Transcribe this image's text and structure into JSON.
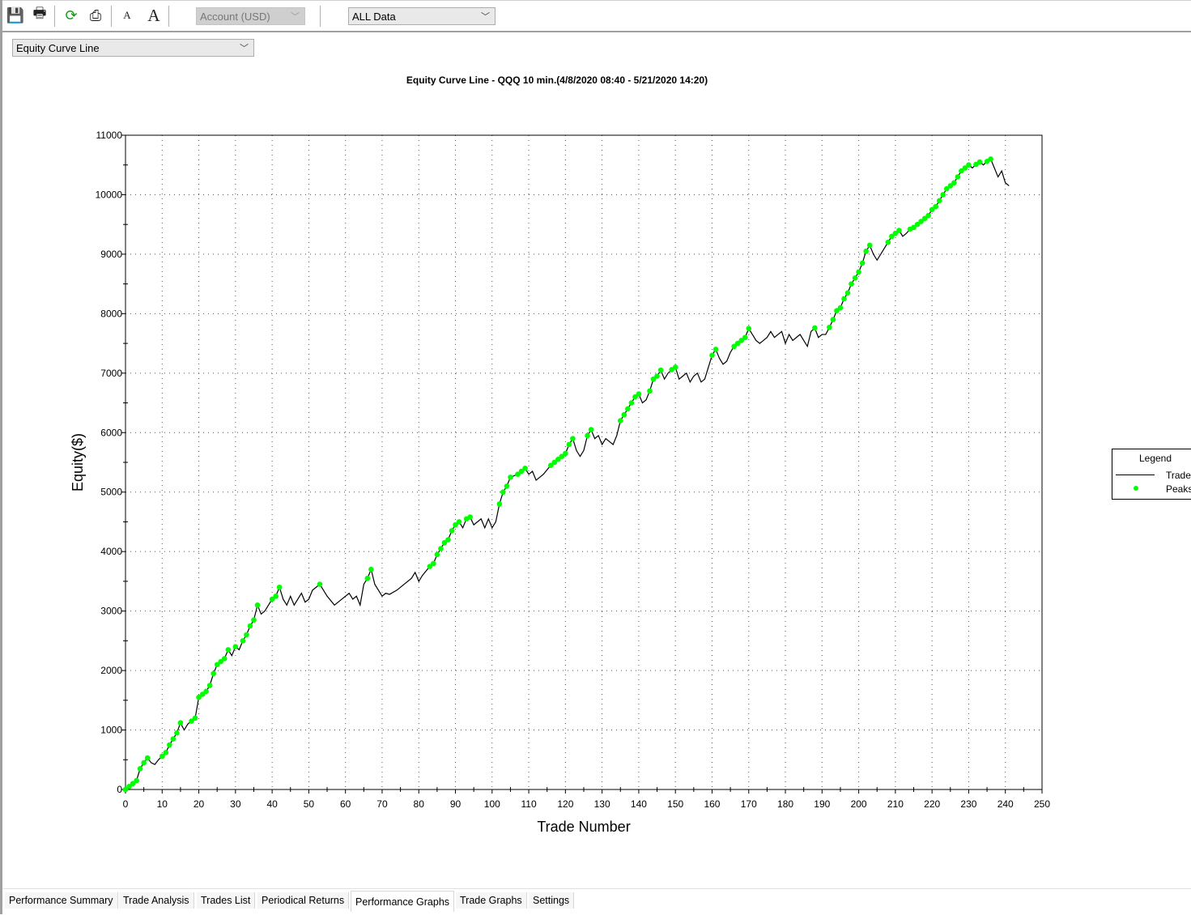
{
  "toolbar": {
    "buttons": [
      {
        "name": "save-icon",
        "glyph": "💾"
      },
      {
        "name": "print-icon",
        "glyph": "🖶"
      },
      {
        "name": "refresh-icon",
        "glyph": "⟳"
      },
      {
        "name": "export-icon",
        "glyph": "⎙"
      },
      {
        "name": "font-smaller-icon",
        "glyph": "A"
      },
      {
        "name": "font-larger-icon",
        "glyph": "A"
      }
    ],
    "account_select": "Account (USD)",
    "data_select": "ALL Data"
  },
  "graph_select": "Equity Curve Line",
  "legend": {
    "title": "Legend",
    "items": [
      "Trades",
      "Peaks"
    ]
  },
  "tabs": [
    {
      "label": "Performance Summary"
    },
    {
      "label": "Trade Analysis"
    },
    {
      "label": "Trades List"
    },
    {
      "label": "Periodical Returns"
    },
    {
      "label": "Performance Graphs",
      "active": true
    },
    {
      "label": "Trade Graphs"
    },
    {
      "label": "Settings"
    }
  ],
  "chart_data": {
    "type": "line",
    "title": "Equity Curve Line - QQQ 10 min.(4/8/2020 08:40 - 5/21/2020 14:20)",
    "xlabel": "Trade Number",
    "ylabel": "Equity($)",
    "xlim": [
      0,
      250
    ],
    "ylim": [
      0,
      11000
    ],
    "xticks": [
      0,
      10,
      20,
      30,
      40,
      50,
      60,
      70,
      80,
      90,
      100,
      110,
      120,
      130,
      140,
      150,
      160,
      170,
      180,
      190,
      200,
      210,
      220,
      230,
      240,
      250
    ],
    "yticks": [
      0,
      1000,
      2000,
      3000,
      4000,
      5000,
      6000,
      7000,
      8000,
      9000,
      10000,
      11000
    ],
    "grid": true,
    "legend_placement": "right",
    "colors": {
      "trades": "#000000",
      "peaks": "#00ff00"
    },
    "series": [
      {
        "name": "Trades",
        "points": [
          [
            0,
            0
          ],
          [
            1,
            50
          ],
          [
            2,
            100
          ],
          [
            3,
            150
          ],
          [
            4,
            350
          ],
          [
            5,
            450
          ],
          [
            6,
            530
          ],
          [
            7,
            450
          ],
          [
            8,
            420
          ],
          [
            9,
            500
          ],
          [
            10,
            560
          ],
          [
            11,
            620
          ],
          [
            12,
            750
          ],
          [
            13,
            850
          ],
          [
            14,
            950
          ],
          [
            15,
            1120
          ],
          [
            16,
            1000
          ],
          [
            17,
            1100
          ],
          [
            18,
            1150
          ],
          [
            19,
            1200
          ],
          [
            20,
            1550
          ],
          [
            21,
            1600
          ],
          [
            22,
            1650
          ],
          [
            23,
            1750
          ],
          [
            24,
            1950
          ],
          [
            25,
            2100
          ],
          [
            26,
            2150
          ],
          [
            27,
            2200
          ],
          [
            28,
            2350
          ],
          [
            29,
            2250
          ],
          [
            30,
            2400
          ],
          [
            31,
            2350
          ],
          [
            32,
            2500
          ],
          [
            33,
            2600
          ],
          [
            34,
            2750
          ],
          [
            35,
            2850
          ],
          [
            36,
            3100
          ],
          [
            37,
            2950
          ],
          [
            38,
            3000
          ],
          [
            39,
            3100
          ],
          [
            40,
            3200
          ],
          [
            41,
            3250
          ],
          [
            42,
            3400
          ],
          [
            43,
            3200
          ],
          [
            44,
            3100
          ],
          [
            45,
            3250
          ],
          [
            46,
            3100
          ],
          [
            47,
            3200
          ],
          [
            48,
            3300
          ],
          [
            49,
            3150
          ],
          [
            50,
            3200
          ],
          [
            51,
            3350
          ],
          [
            52,
            3400
          ],
          [
            53,
            3450
          ],
          [
            55,
            3250
          ],
          [
            57,
            3100
          ],
          [
            59,
            3200
          ],
          [
            61,
            3300
          ],
          [
            62,
            3200
          ],
          [
            63,
            3250
          ],
          [
            64,
            3100
          ],
          [
            65,
            3450
          ],
          [
            66,
            3550
          ],
          [
            67,
            3700
          ],
          [
            68,
            3450
          ],
          [
            70,
            3250
          ],
          [
            71,
            3300
          ],
          [
            72,
            3280
          ],
          [
            74,
            3350
          ],
          [
            76,
            3450
          ],
          [
            78,
            3550
          ],
          [
            79,
            3650
          ],
          [
            80,
            3500
          ],
          [
            81,
            3600
          ],
          [
            83,
            3750
          ],
          [
            84,
            3800
          ],
          [
            85,
            3950
          ],
          [
            86,
            4050
          ],
          [
            87,
            4150
          ],
          [
            88,
            4200
          ],
          [
            89,
            4350
          ],
          [
            90,
            4450
          ],
          [
            91,
            4500
          ],
          [
            92,
            4400
          ],
          [
            93,
            4550
          ],
          [
            94,
            4580
          ],
          [
            95,
            4450
          ],
          [
            97,
            4550
          ],
          [
            98,
            4400
          ],
          [
            99,
            4550
          ],
          [
            100,
            4400
          ],
          [
            101,
            4500
          ],
          [
            102,
            4800
          ],
          [
            103,
            5000
          ],
          [
            104,
            5100
          ],
          [
            105,
            5250
          ],
          [
            107,
            5300
          ],
          [
            108,
            5350
          ],
          [
            109,
            5400
          ],
          [
            110,
            5300
          ],
          [
            111,
            5350
          ],
          [
            112,
            5200
          ],
          [
            114,
            5300
          ],
          [
            116,
            5450
          ],
          [
            117,
            5500
          ],
          [
            118,
            5550
          ],
          [
            119,
            5600
          ],
          [
            120,
            5650
          ],
          [
            121,
            5800
          ],
          [
            122,
            5900
          ],
          [
            123,
            5700
          ],
          [
            124,
            5600
          ],
          [
            125,
            5700
          ],
          [
            126,
            5950
          ],
          [
            127,
            6050
          ],
          [
            128,
            5900
          ],
          [
            129,
            5950
          ],
          [
            130,
            5800
          ],
          [
            131,
            5900
          ],
          [
            132,
            5850
          ],
          [
            133,
            5800
          ],
          [
            134,
            5950
          ],
          [
            135,
            6200
          ],
          [
            136,
            6300
          ],
          [
            137,
            6400
          ],
          [
            138,
            6500
          ],
          [
            139,
            6600
          ],
          [
            140,
            6650
          ],
          [
            141,
            6500
          ],
          [
            142,
            6550
          ],
          [
            143,
            6700
          ],
          [
            144,
            6900
          ],
          [
            145,
            6950
          ],
          [
            146,
            7050
          ],
          [
            147,
            6900
          ],
          [
            148,
            7000
          ],
          [
            149,
            7060
          ],
          [
            150,
            7100
          ],
          [
            151,
            6900
          ],
          [
            152,
            6950
          ],
          [
            153,
            7000
          ],
          [
            154,
            6850
          ],
          [
            155,
            6950
          ],
          [
            156,
            7000
          ],
          [
            157,
            6850
          ],
          [
            158,
            6900
          ],
          [
            159,
            7100
          ],
          [
            160,
            7300
          ],
          [
            161,
            7400
          ],
          [
            162,
            7250
          ],
          [
            163,
            7150
          ],
          [
            164,
            7200
          ],
          [
            165,
            7350
          ],
          [
            166,
            7450
          ],
          [
            167,
            7500
          ],
          [
            168,
            7550
          ],
          [
            169,
            7600
          ],
          [
            170,
            7750
          ],
          [
            171,
            7650
          ],
          [
            172,
            7550
          ],
          [
            173,
            7500
          ],
          [
            174,
            7550
          ],
          [
            175,
            7600
          ],
          [
            176,
            7700
          ],
          [
            177,
            7600
          ],
          [
            178,
            7650
          ],
          [
            179,
            7700
          ],
          [
            180,
            7500
          ],
          [
            181,
            7650
          ],
          [
            182,
            7550
          ],
          [
            183,
            7600
          ],
          [
            184,
            7650
          ],
          [
            185,
            7550
          ],
          [
            186,
            7450
          ],
          [
            187,
            7700
          ],
          [
            188,
            7760
          ],
          [
            189,
            7600
          ],
          [
            190,
            7650
          ],
          [
            191,
            7650
          ],
          [
            192,
            7770
          ],
          [
            193,
            7900
          ],
          [
            194,
            8050
          ],
          [
            195,
            8100
          ],
          [
            196,
            8250
          ],
          [
            197,
            8350
          ],
          [
            198,
            8500
          ],
          [
            199,
            8600
          ],
          [
            200,
            8700
          ],
          [
            201,
            8850
          ],
          [
            202,
            9050
          ],
          [
            203,
            9150
          ],
          [
            204,
            9000
          ],
          [
            205,
            8900
          ],
          [
            206,
            9000
          ],
          [
            207,
            9100
          ],
          [
            208,
            9200
          ],
          [
            209,
            9300
          ],
          [
            210,
            9350
          ],
          [
            211,
            9400
          ],
          [
            212,
            9300
          ],
          [
            213,
            9350
          ],
          [
            214,
            9420
          ],
          [
            215,
            9450
          ],
          [
            216,
            9500
          ],
          [
            217,
            9550
          ],
          [
            218,
            9600
          ],
          [
            219,
            9650
          ],
          [
            220,
            9750
          ],
          [
            221,
            9800
          ],
          [
            222,
            9900
          ],
          [
            223,
            10000
          ],
          [
            224,
            10100
          ],
          [
            225,
            10150
          ],
          [
            226,
            10200
          ],
          [
            227,
            10300
          ],
          [
            228,
            10400
          ],
          [
            229,
            10450
          ],
          [
            230,
            10500
          ],
          [
            231,
            10450
          ],
          [
            232,
            10510
          ],
          [
            233,
            10550
          ],
          [
            234,
            10500
          ],
          [
            235,
            10560
          ],
          [
            236,
            10600
          ],
          [
            237,
            10450
          ],
          [
            238,
            10300
          ],
          [
            239,
            10400
          ],
          [
            240,
            10200
          ],
          [
            241,
            10150
          ]
        ]
      },
      {
        "name": "Peaks",
        "rule": "new equity high"
      }
    ]
  }
}
